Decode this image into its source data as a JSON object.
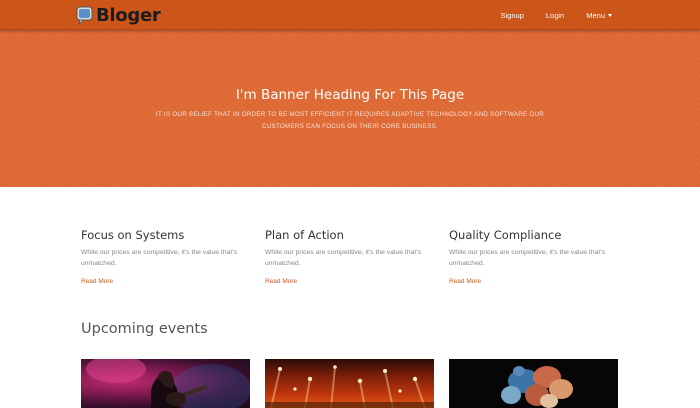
{
  "brand": {
    "name": "Bloger",
    "icon": "speech-bubble-icon"
  },
  "nav": {
    "signup": "Signup",
    "login": "Login",
    "menu": "Menu"
  },
  "banner": {
    "heading": "I'm Banner Heading For This Page",
    "subtext": "It is our belief that in order to be most efficient it requires adaptive technology and software our customers can focus on their core business."
  },
  "features": [
    {
      "title": "Focus on Systems",
      "text": "While our prices are competitive, it's the value that's unmatched.",
      "link": "Read More"
    },
    {
      "title": "Plan of Action",
      "text": "While our prices are competitive, it's the value that's unmatched.",
      "link": "Read More"
    },
    {
      "title": "Quality Compliance",
      "text": "While our prices are competitive, it's the value that's unmatched.",
      "link": "Read More"
    }
  ],
  "events": {
    "title": "Upcoming events"
  },
  "colors": {
    "nav": "#cc5519",
    "banner": "#e06a35",
    "link": "#cc5a23"
  }
}
